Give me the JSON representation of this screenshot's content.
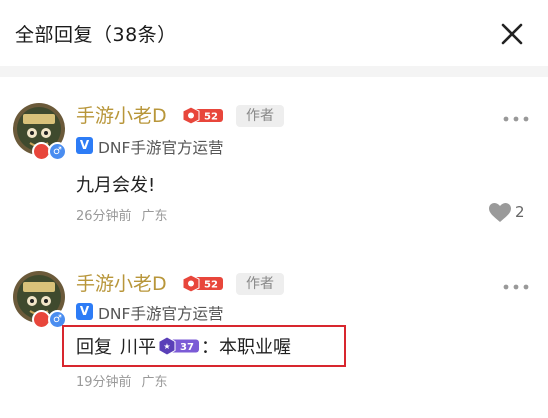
{
  "header": {
    "title": "全部回复（38条）"
  },
  "comments": [
    {
      "username": "手游小老D",
      "level": "52",
      "author_tag": "作者",
      "verify_text": "DNF手游官方运营",
      "content": "九月会发!",
      "time": "26分钟前",
      "location": "广东",
      "likes": "2"
    },
    {
      "username": "手游小老D",
      "level": "52",
      "author_tag": "作者",
      "verify_text": "DNF手游官方运营",
      "reply_prefix": "回复",
      "reply_to": "川平",
      "reply_to_level": "37",
      "reply_colon": "：",
      "reply_text": "本职业喔",
      "time": "19分钟前",
      "location": "广东"
    }
  ],
  "colors": {
    "username": "#b8963a",
    "level_badge": "#e8463b",
    "reply_level_badge": "#7b5bd6",
    "highlight_border": "#d8262e",
    "verify": "#2d7cf6"
  },
  "icons": {
    "close": "close-icon",
    "more": "more-icon",
    "like": "heart-icon",
    "verify": "v-verified-icon",
    "gender": "male-icon"
  }
}
